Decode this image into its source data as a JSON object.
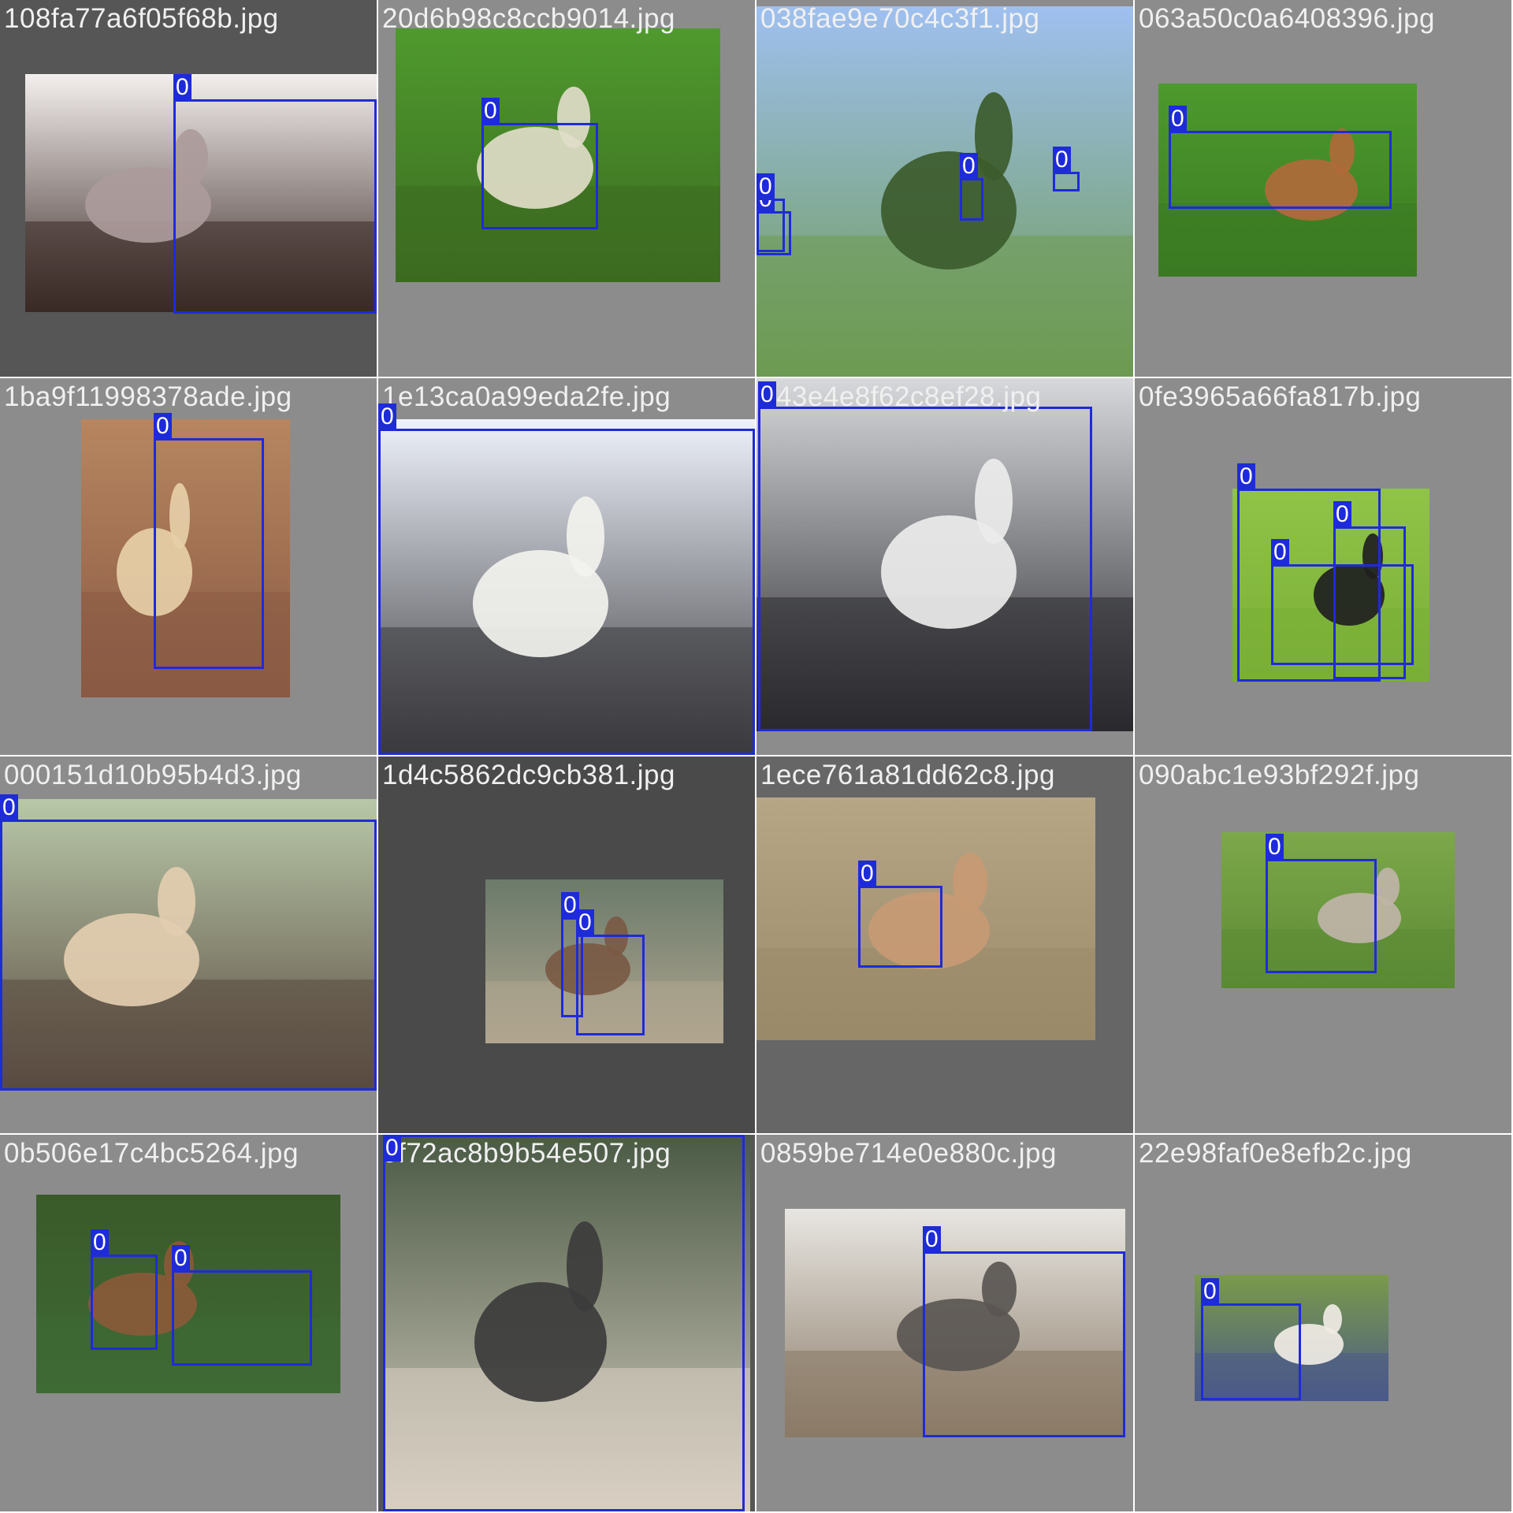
{
  "tiles": [
    {
      "filename": "108fa77a6f05f68b.jpg",
      "bg": "#565656",
      "scene": [
        "#f4efee",
        "#3a2a26",
        "#ab9b9a"
      ],
      "boxes": [
        {
          "label": "0"
        }
      ]
    },
    {
      "filename": "20d6b98c8ccb9014.jpg",
      "bg": "#8c8c8c",
      "scene": [
        "#4f9a2e",
        "#3c6b20",
        "#e0dcc8"
      ],
      "boxes": [
        {
          "label": "0"
        }
      ]
    },
    {
      "filename": "038fae9e70c4c3f1.jpg",
      "bg": "#8c8c8c",
      "scene": [
        "#9fc0f0",
        "#6d9a52",
        "#3c5b2c"
      ],
      "boxes": [
        {
          "label": "0"
        },
        {
          "label": "0"
        },
        {
          "label": "0"
        },
        {
          "label": "0"
        }
      ]
    },
    {
      "filename": "063a50c0a6408396.jpg",
      "bg": "#8c8c8c",
      "scene": [
        "#4d9a2d",
        "#3b7a22",
        "#b06a3a"
      ],
      "boxes": [
        {
          "label": "0"
        }
      ]
    },
    {
      "filename": "1ba9f11998378ade.jpg",
      "bg": "#8c8c8c",
      "scene": [
        "#b78660",
        "#8a5a44",
        "#e6cfa8"
      ],
      "boxes": [
        {
          "label": "0"
        }
      ]
    },
    {
      "filename": "1e13ca0a99eda2fe.jpg",
      "bg": "#8c8c8c",
      "scene": [
        "#eef2fb",
        "#3a3a3e",
        "#f2f2ee"
      ],
      "boxes": [
        {
          "label": "0"
        }
      ]
    },
    {
      "filename": "043e4e8f62c8ef28.jpg",
      "bg": "#8c8c8c",
      "scene": [
        "#d6d8dc",
        "#2a2a2e",
        "#ececec"
      ],
      "boxes": [
        {
          "label": "0"
        }
      ]
    },
    {
      "filename": "0fe3965a66fa817b.jpg",
      "bg": "#8c8c8c",
      "scene": [
        "#8fc447",
        "#7aae37",
        "#1f1f1f"
      ],
      "boxes": [
        {
          "label": "0"
        },
        {
          "label": "0"
        },
        {
          "label": "0"
        }
      ]
    },
    {
      "filename": "000151d10b95b4d3.jpg",
      "bg": "#8c8c8c",
      "scene": [
        "#b8c8a8",
        "#5a4a40",
        "#e3cdb0"
      ],
      "boxes": [
        {
          "label": "0"
        }
      ]
    },
    {
      "filename": "1d4c5862dc9cb381.jpg",
      "bg": "#4a4a4a",
      "scene": [
        "#6b7a6a",
        "#b0a690",
        "#7a5a44"
      ],
      "boxes": [
        {
          "label": "0"
        },
        {
          "label": "0"
        }
      ]
    },
    {
      "filename": "1ece761a81dd62c8.jpg",
      "bg": "#666666",
      "scene": [
        "#b7a686",
        "#9a8a6a",
        "#c79a74"
      ],
      "boxes": [
        {
          "label": "0"
        }
      ]
    },
    {
      "filename": "090abc1e93bf292f.jpg",
      "bg": "#8c8c8c",
      "scene": [
        "#7da84a",
        "#5b8a34",
        "#c0b4a8"
      ],
      "boxes": [
        {
          "label": "0"
        }
      ]
    },
    {
      "filename": "0b506e17c4bc5264.jpg",
      "bg": "#8c8c8c",
      "scene": [
        "#3a5a2a",
        "#3e6a34",
        "#8a5a3a"
      ],
      "boxes": [
        {
          "label": "0"
        },
        {
          "label": "0"
        }
      ]
    },
    {
      "filename": "0f72ac8b9b54e507.jpg",
      "bg": "#565656",
      "scene": [
        "#4a5a44",
        "#d8cfc2",
        "#3c3c3c"
      ],
      "boxes": [
        {
          "label": "0"
        }
      ]
    },
    {
      "filename": "0859be714e0e880c.jpg",
      "bg": "#8c8c8c",
      "scene": [
        "#e8e6e2",
        "#8a7a66",
        "#5a5652"
      ],
      "boxes": [
        {
          "label": "0"
        }
      ]
    },
    {
      "filename": "22e98faf0e8efb2c.jpg",
      "bg": "#8c8c8c",
      "scene": [
        "#7a9a4a",
        "#4a5a8a",
        "#f0ece4"
      ],
      "boxes": [
        {
          "label": "0"
        }
      ]
    }
  ],
  "colors": {
    "box": "#1e2bd9",
    "label_text": "#ffffff",
    "filename_text": "#f0f0f0"
  }
}
